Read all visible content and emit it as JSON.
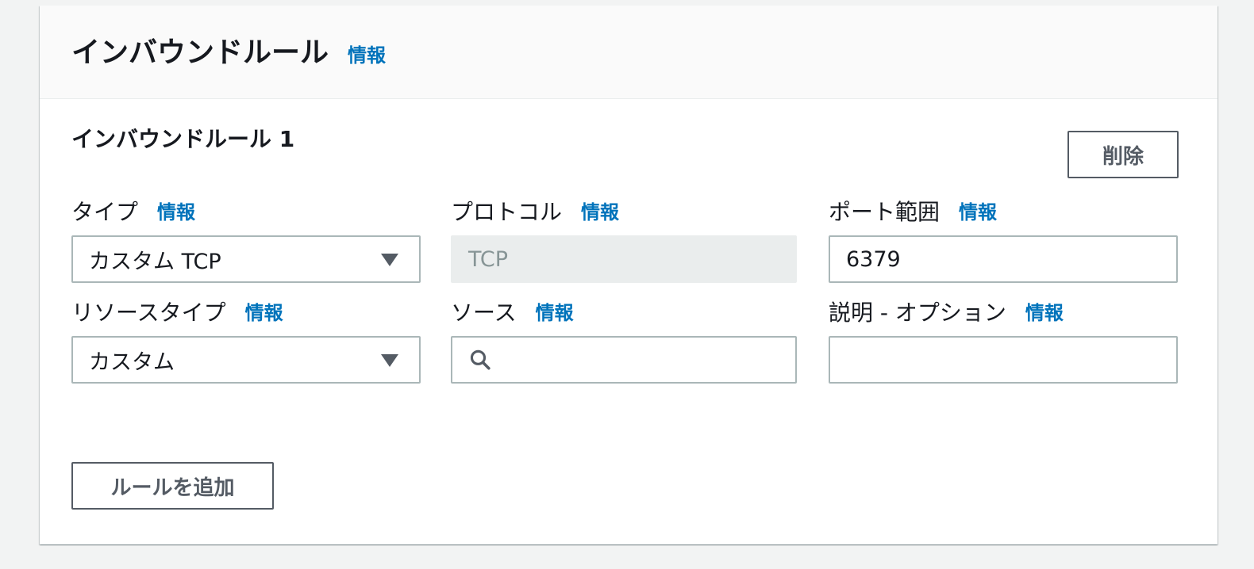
{
  "panel": {
    "title": "インバウンドルール",
    "info_label": "情報"
  },
  "rule": {
    "title": "インバウンドルール 1",
    "delete_label": "削除",
    "fields": {
      "type": {
        "label": "タイプ",
        "info": "情報",
        "value": "カスタム TCP"
      },
      "protocol": {
        "label": "プロトコル",
        "info": "情報",
        "value": "TCP"
      },
      "port_range": {
        "label": "ポート範囲",
        "info": "情報",
        "value": "6379"
      },
      "resource_type": {
        "label": "リソースタイプ",
        "info": "情報",
        "value": "カスタム"
      },
      "source": {
        "label": "ソース",
        "info": "情報",
        "value": ""
      },
      "description": {
        "label": "説明 - オプション",
        "info": "情報",
        "value": ""
      }
    }
  },
  "add_rule_label": "ルールを追加",
  "colors": {
    "link": "#0073bb",
    "border": "#aab7b8",
    "button_border": "#545b64",
    "disabled_bg": "#eaeded",
    "disabled_text": "#879596",
    "header_bg": "#fafafa",
    "page_bg": "#f2f3f3"
  },
  "icons": {
    "dropdown": "caret-down-icon",
    "search": "search-icon"
  }
}
